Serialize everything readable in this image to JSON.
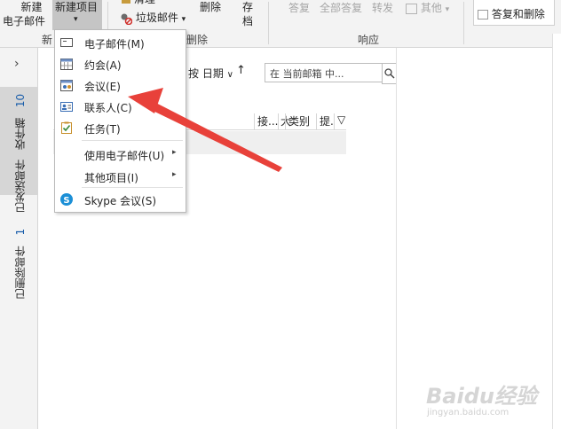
{
  "ribbon": {
    "new_email_line1": "新建",
    "new_email_line2": "电子邮件",
    "new_items": "新建项目",
    "new_items_arrow": "▾",
    "new_group_label": "新",
    "cleanup_partial": "清理",
    "junk": "垃圾邮件",
    "junk_arrow": "▾",
    "delete": "删除",
    "delete_group_label": "删除",
    "archive_line1": "存",
    "archive_line2": "档",
    "reply": "答复",
    "reply_all": "全部答复",
    "forward": "转发",
    "more": "其他",
    "more_arrow": "▾",
    "respond_group_label": "响应",
    "reply_delete": "答复和删除"
  },
  "dropdown_menu": {
    "items": [
      {
        "label": "电子邮件(M)",
        "icon": "email-icon"
      },
      {
        "label": "约会(A)",
        "icon": "calendar-icon"
      },
      {
        "label": "会议(E)",
        "icon": "meeting-icon"
      },
      {
        "label": "联系人(C)",
        "icon": "contact-icon"
      },
      {
        "label": "任务(T)",
        "icon": "task-icon"
      },
      {
        "label": "使用电子邮件(U)",
        "submenu": true
      },
      {
        "label": "其他项目(I)",
        "submenu": true
      },
      {
        "label": "Skype 会议(S)",
        "icon": "skype-icon"
      }
    ],
    "submenu_arrow": "▸"
  },
  "left_nav": {
    "expand_icon": "›",
    "inbox_label": "收件箱",
    "inbox_count": "10",
    "sent_label": "已发送邮件",
    "deleted_label": "已删除邮件",
    "deleted_count": "1"
  },
  "message_list": {
    "sort_label": "按 日期",
    "sort_partial": "按",
    "sort_arrow": "∨",
    "sort_dir_icon": "↑",
    "search_placeholder": "在 当前邮箱 中...",
    "search_icon": "magnifier-icon",
    "columns": [
      "接...",
      "大",
      "类别",
      "提.",
      "▽"
    ]
  },
  "watermark": {
    "brand": "Baidu经验",
    "site": "jingyan.baidu.com"
  },
  "colors": {
    "accent_blue": "#1b5eaa",
    "annotation_red": "#e8413a",
    "selected_menu": "#d6d6d6"
  }
}
